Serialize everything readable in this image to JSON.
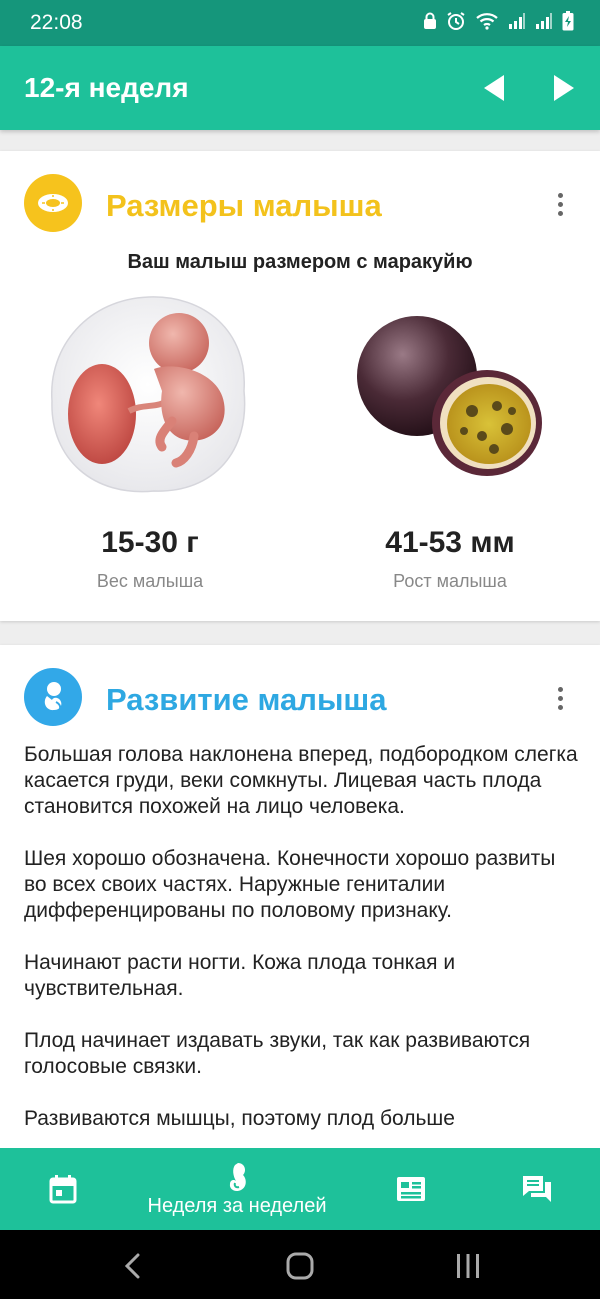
{
  "status_bar": {
    "time": "22:08"
  },
  "app_bar": {
    "title": "12-я неделя"
  },
  "size_card": {
    "title": "Размеры малыша",
    "title_color": "#f3c21c",
    "icon_bg": "#f6c31d",
    "subtitle": "Ваш малыш размером с маракуйю",
    "weight_value": "15-30 г",
    "weight_label": "Вес малыша",
    "height_value": "41-53 мм",
    "height_label": "Рост малыша"
  },
  "development_card": {
    "title": "Развитие малыша",
    "title_color": "#2ea8e2",
    "icon_bg": "#32a8e8",
    "paragraphs": [
      "Большая голова наклонена вперед, подбородком слегка касается груди, веки сомкнуты. Лицевая часть плода становится похожей на лицо человека.",
      "Шея хорошо обозначена. Конечности хорошо развиты во всех своих частях. Наружные гениталии дифференцированы по половому признаку.",
      "Начинают расти ногти. Кожа плода тонкая и чувствительная.",
      "Плод начинает издавать звуки, так как развиваются голосовые связки.",
      "Развиваются мышцы, поэтому плод больше"
    ]
  },
  "bottom_nav": {
    "active_label": "Неделя за неделей",
    "items": [
      "calendar-icon",
      "baby-icon",
      "news-icon",
      "chat-icon"
    ]
  },
  "colors": {
    "status_bar": "#15967b",
    "primary": "#1ec19a"
  }
}
